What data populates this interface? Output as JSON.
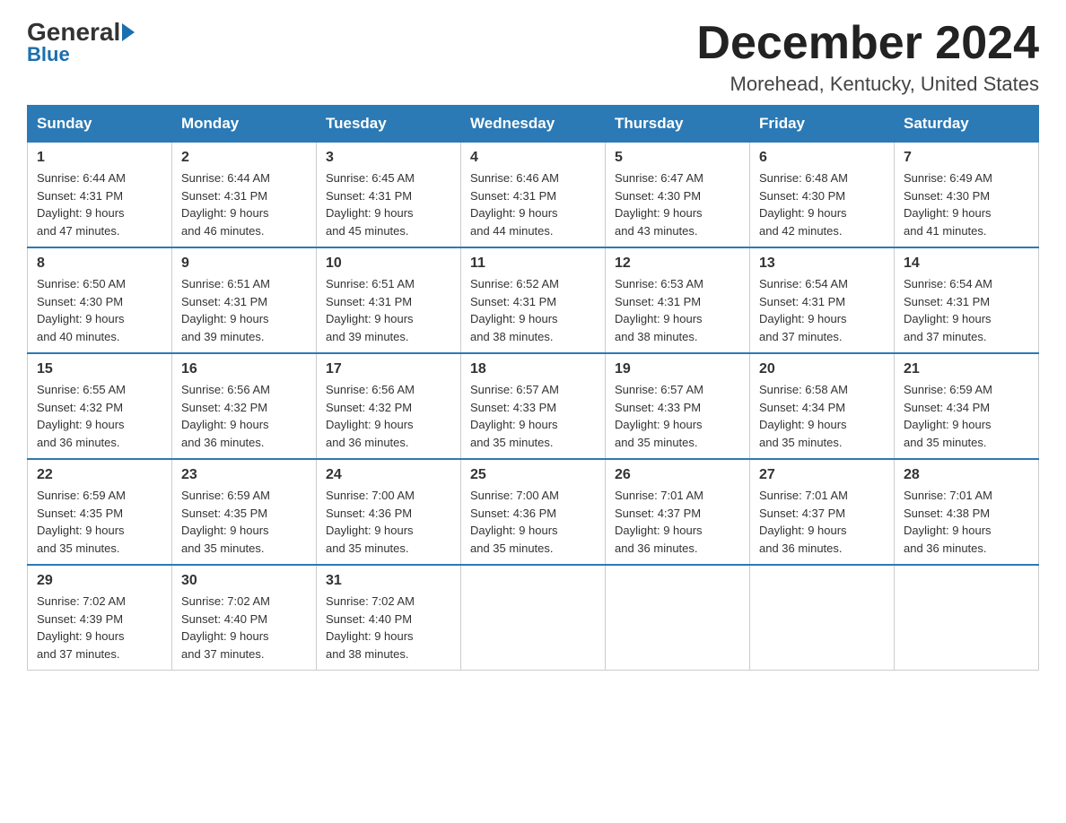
{
  "header": {
    "logo_general": "General",
    "logo_blue": "Blue",
    "month_title": "December 2024",
    "location": "Morehead, Kentucky, United States"
  },
  "days_of_week": [
    "Sunday",
    "Monday",
    "Tuesday",
    "Wednesday",
    "Thursday",
    "Friday",
    "Saturday"
  ],
  "weeks": [
    [
      {
        "num": "1",
        "sunrise": "6:44 AM",
        "sunset": "4:31 PM",
        "daylight": "9 hours and 47 minutes."
      },
      {
        "num": "2",
        "sunrise": "6:44 AM",
        "sunset": "4:31 PM",
        "daylight": "9 hours and 46 minutes."
      },
      {
        "num": "3",
        "sunrise": "6:45 AM",
        "sunset": "4:31 PM",
        "daylight": "9 hours and 45 minutes."
      },
      {
        "num": "4",
        "sunrise": "6:46 AM",
        "sunset": "4:31 PM",
        "daylight": "9 hours and 44 minutes."
      },
      {
        "num": "5",
        "sunrise": "6:47 AM",
        "sunset": "4:30 PM",
        "daylight": "9 hours and 43 minutes."
      },
      {
        "num": "6",
        "sunrise": "6:48 AM",
        "sunset": "4:30 PM",
        "daylight": "9 hours and 42 minutes."
      },
      {
        "num": "7",
        "sunrise": "6:49 AM",
        "sunset": "4:30 PM",
        "daylight": "9 hours and 41 minutes."
      }
    ],
    [
      {
        "num": "8",
        "sunrise": "6:50 AM",
        "sunset": "4:30 PM",
        "daylight": "9 hours and 40 minutes."
      },
      {
        "num": "9",
        "sunrise": "6:51 AM",
        "sunset": "4:31 PM",
        "daylight": "9 hours and 39 minutes."
      },
      {
        "num": "10",
        "sunrise": "6:51 AM",
        "sunset": "4:31 PM",
        "daylight": "9 hours and 39 minutes."
      },
      {
        "num": "11",
        "sunrise": "6:52 AM",
        "sunset": "4:31 PM",
        "daylight": "9 hours and 38 minutes."
      },
      {
        "num": "12",
        "sunrise": "6:53 AM",
        "sunset": "4:31 PM",
        "daylight": "9 hours and 38 minutes."
      },
      {
        "num": "13",
        "sunrise": "6:54 AM",
        "sunset": "4:31 PM",
        "daylight": "9 hours and 37 minutes."
      },
      {
        "num": "14",
        "sunrise": "6:54 AM",
        "sunset": "4:31 PM",
        "daylight": "9 hours and 37 minutes."
      }
    ],
    [
      {
        "num": "15",
        "sunrise": "6:55 AM",
        "sunset": "4:32 PM",
        "daylight": "9 hours and 36 minutes."
      },
      {
        "num": "16",
        "sunrise": "6:56 AM",
        "sunset": "4:32 PM",
        "daylight": "9 hours and 36 minutes."
      },
      {
        "num": "17",
        "sunrise": "6:56 AM",
        "sunset": "4:32 PM",
        "daylight": "9 hours and 36 minutes."
      },
      {
        "num": "18",
        "sunrise": "6:57 AM",
        "sunset": "4:33 PM",
        "daylight": "9 hours and 35 minutes."
      },
      {
        "num": "19",
        "sunrise": "6:57 AM",
        "sunset": "4:33 PM",
        "daylight": "9 hours and 35 minutes."
      },
      {
        "num": "20",
        "sunrise": "6:58 AM",
        "sunset": "4:34 PM",
        "daylight": "9 hours and 35 minutes."
      },
      {
        "num": "21",
        "sunrise": "6:59 AM",
        "sunset": "4:34 PM",
        "daylight": "9 hours and 35 minutes."
      }
    ],
    [
      {
        "num": "22",
        "sunrise": "6:59 AM",
        "sunset": "4:35 PM",
        "daylight": "9 hours and 35 minutes."
      },
      {
        "num": "23",
        "sunrise": "6:59 AM",
        "sunset": "4:35 PM",
        "daylight": "9 hours and 35 minutes."
      },
      {
        "num": "24",
        "sunrise": "7:00 AM",
        "sunset": "4:36 PM",
        "daylight": "9 hours and 35 minutes."
      },
      {
        "num": "25",
        "sunrise": "7:00 AM",
        "sunset": "4:36 PM",
        "daylight": "9 hours and 35 minutes."
      },
      {
        "num": "26",
        "sunrise": "7:01 AM",
        "sunset": "4:37 PM",
        "daylight": "9 hours and 36 minutes."
      },
      {
        "num": "27",
        "sunrise": "7:01 AM",
        "sunset": "4:37 PM",
        "daylight": "9 hours and 36 minutes."
      },
      {
        "num": "28",
        "sunrise": "7:01 AM",
        "sunset": "4:38 PM",
        "daylight": "9 hours and 36 minutes."
      }
    ],
    [
      {
        "num": "29",
        "sunrise": "7:02 AM",
        "sunset": "4:39 PM",
        "daylight": "9 hours and 37 minutes."
      },
      {
        "num": "30",
        "sunrise": "7:02 AM",
        "sunset": "4:40 PM",
        "daylight": "9 hours and 37 minutes."
      },
      {
        "num": "31",
        "sunrise": "7:02 AM",
        "sunset": "4:40 PM",
        "daylight": "9 hours and 38 minutes."
      },
      null,
      null,
      null,
      null
    ]
  ]
}
